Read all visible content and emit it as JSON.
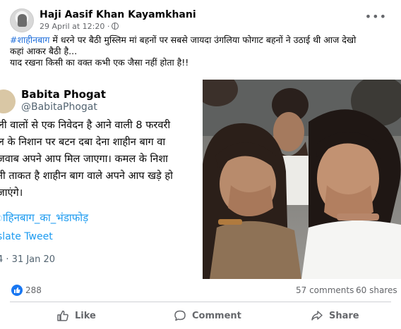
{
  "post": {
    "author": "Haji Aasif Khan Kayamkhani",
    "timestamp": "29 April at 12:20 ·",
    "caption_tag": "#शाहीनबाग",
    "caption_line1_rest": " में धरने पर बैठी मुस्लिम मां बहनों  पर सबसे जायदा उंगलिया फोगाट बहनों ने उठाई थी आज देखो",
    "caption_line2": "कहां आकर बैठी है...",
    "caption_line3": "याद रखना किसी का वक्त कभी एक जैसा नहीं होता है!!"
  },
  "tweet": {
    "name": "Babita Phogat",
    "handle": "@BabitaPhogat",
    "lines": [
      "ली वालों से एक निवेदन है आने वाली 8 फरवरी",
      "ल के निशान पर बटन दबा देना  शाहीन बाग वा",
      "जवाब अपने आप मिल जाएगा। कमल के निशा",
      "नी ताकत है शाहीन बाग वाले अपने आप खड़े हो",
      " जाएंगे।"
    ],
    "hashtag": "ाहिनबाग_का_भंडाफोड़",
    "translate": "slate Tweet",
    "date": "4 · 31 Jan 20"
  },
  "stats": {
    "likes": "288",
    "comments": "57 comments",
    "shares": "60 shares"
  },
  "actions": {
    "like": "Like",
    "comment": "Comment",
    "share": "Share"
  },
  "colors": {
    "link": "#216fdb",
    "twitter_blue": "#1d9bf0",
    "facebook_blue": "#1877f2",
    "secondary_text": "#65676b"
  }
}
